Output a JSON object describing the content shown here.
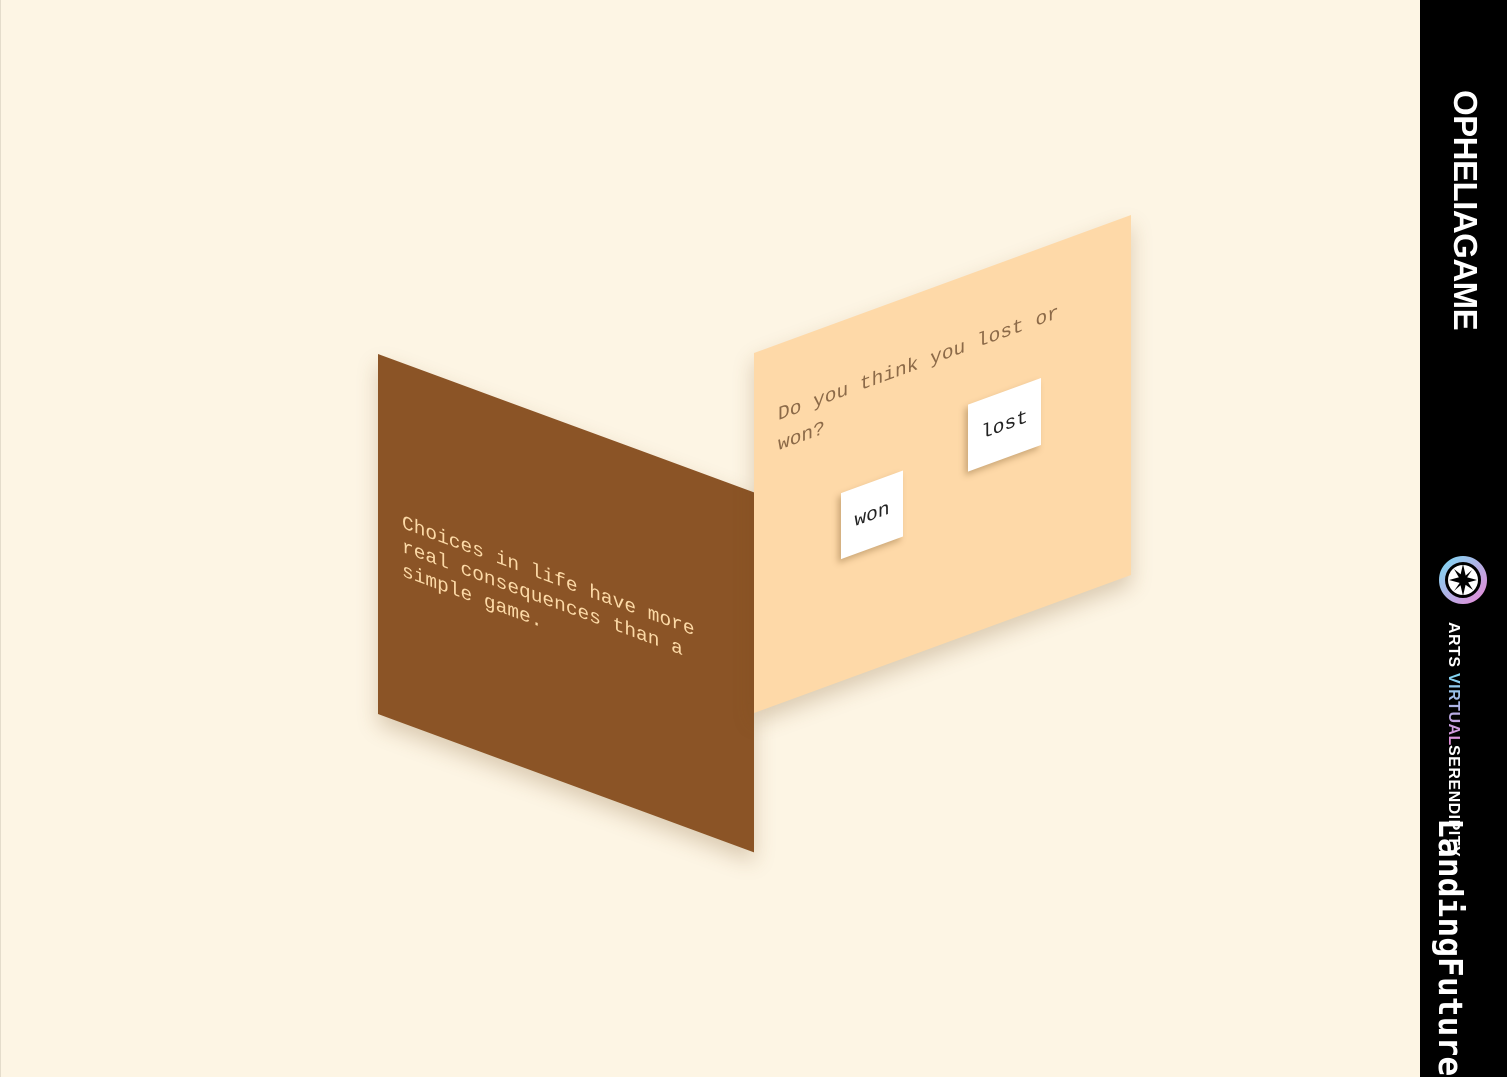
{
  "game": {
    "left_card": {
      "text": "Choices in life have more\nreal consequences than a\nsimple game."
    },
    "right_card": {
      "question": "Do you think you lost or\nwon?",
      "choices": {
        "won": "won",
        "lost": "lost"
      }
    }
  },
  "sidebar": {
    "title": "OPHELIAGAME",
    "partner_logo": {
      "icon": "serendipity-star-icon",
      "line1": "SERENDIPITY",
      "line2_prefix": "ARTS ",
      "line2_accent": "VIRTUAL"
    },
    "festival": {
      "line1": "Future",
      "line2": "Landing"
    }
  },
  "colors": {
    "background": "#fdf5e4",
    "left_card": "#8b5426",
    "left_text": "#fcd9a6",
    "right_card": "#fed9a8",
    "right_text": "#8c6a48",
    "sidebar": "#000000",
    "accent_gradient_start": "#7fd7f3",
    "accent_gradient_end": "#e58bd8"
  }
}
